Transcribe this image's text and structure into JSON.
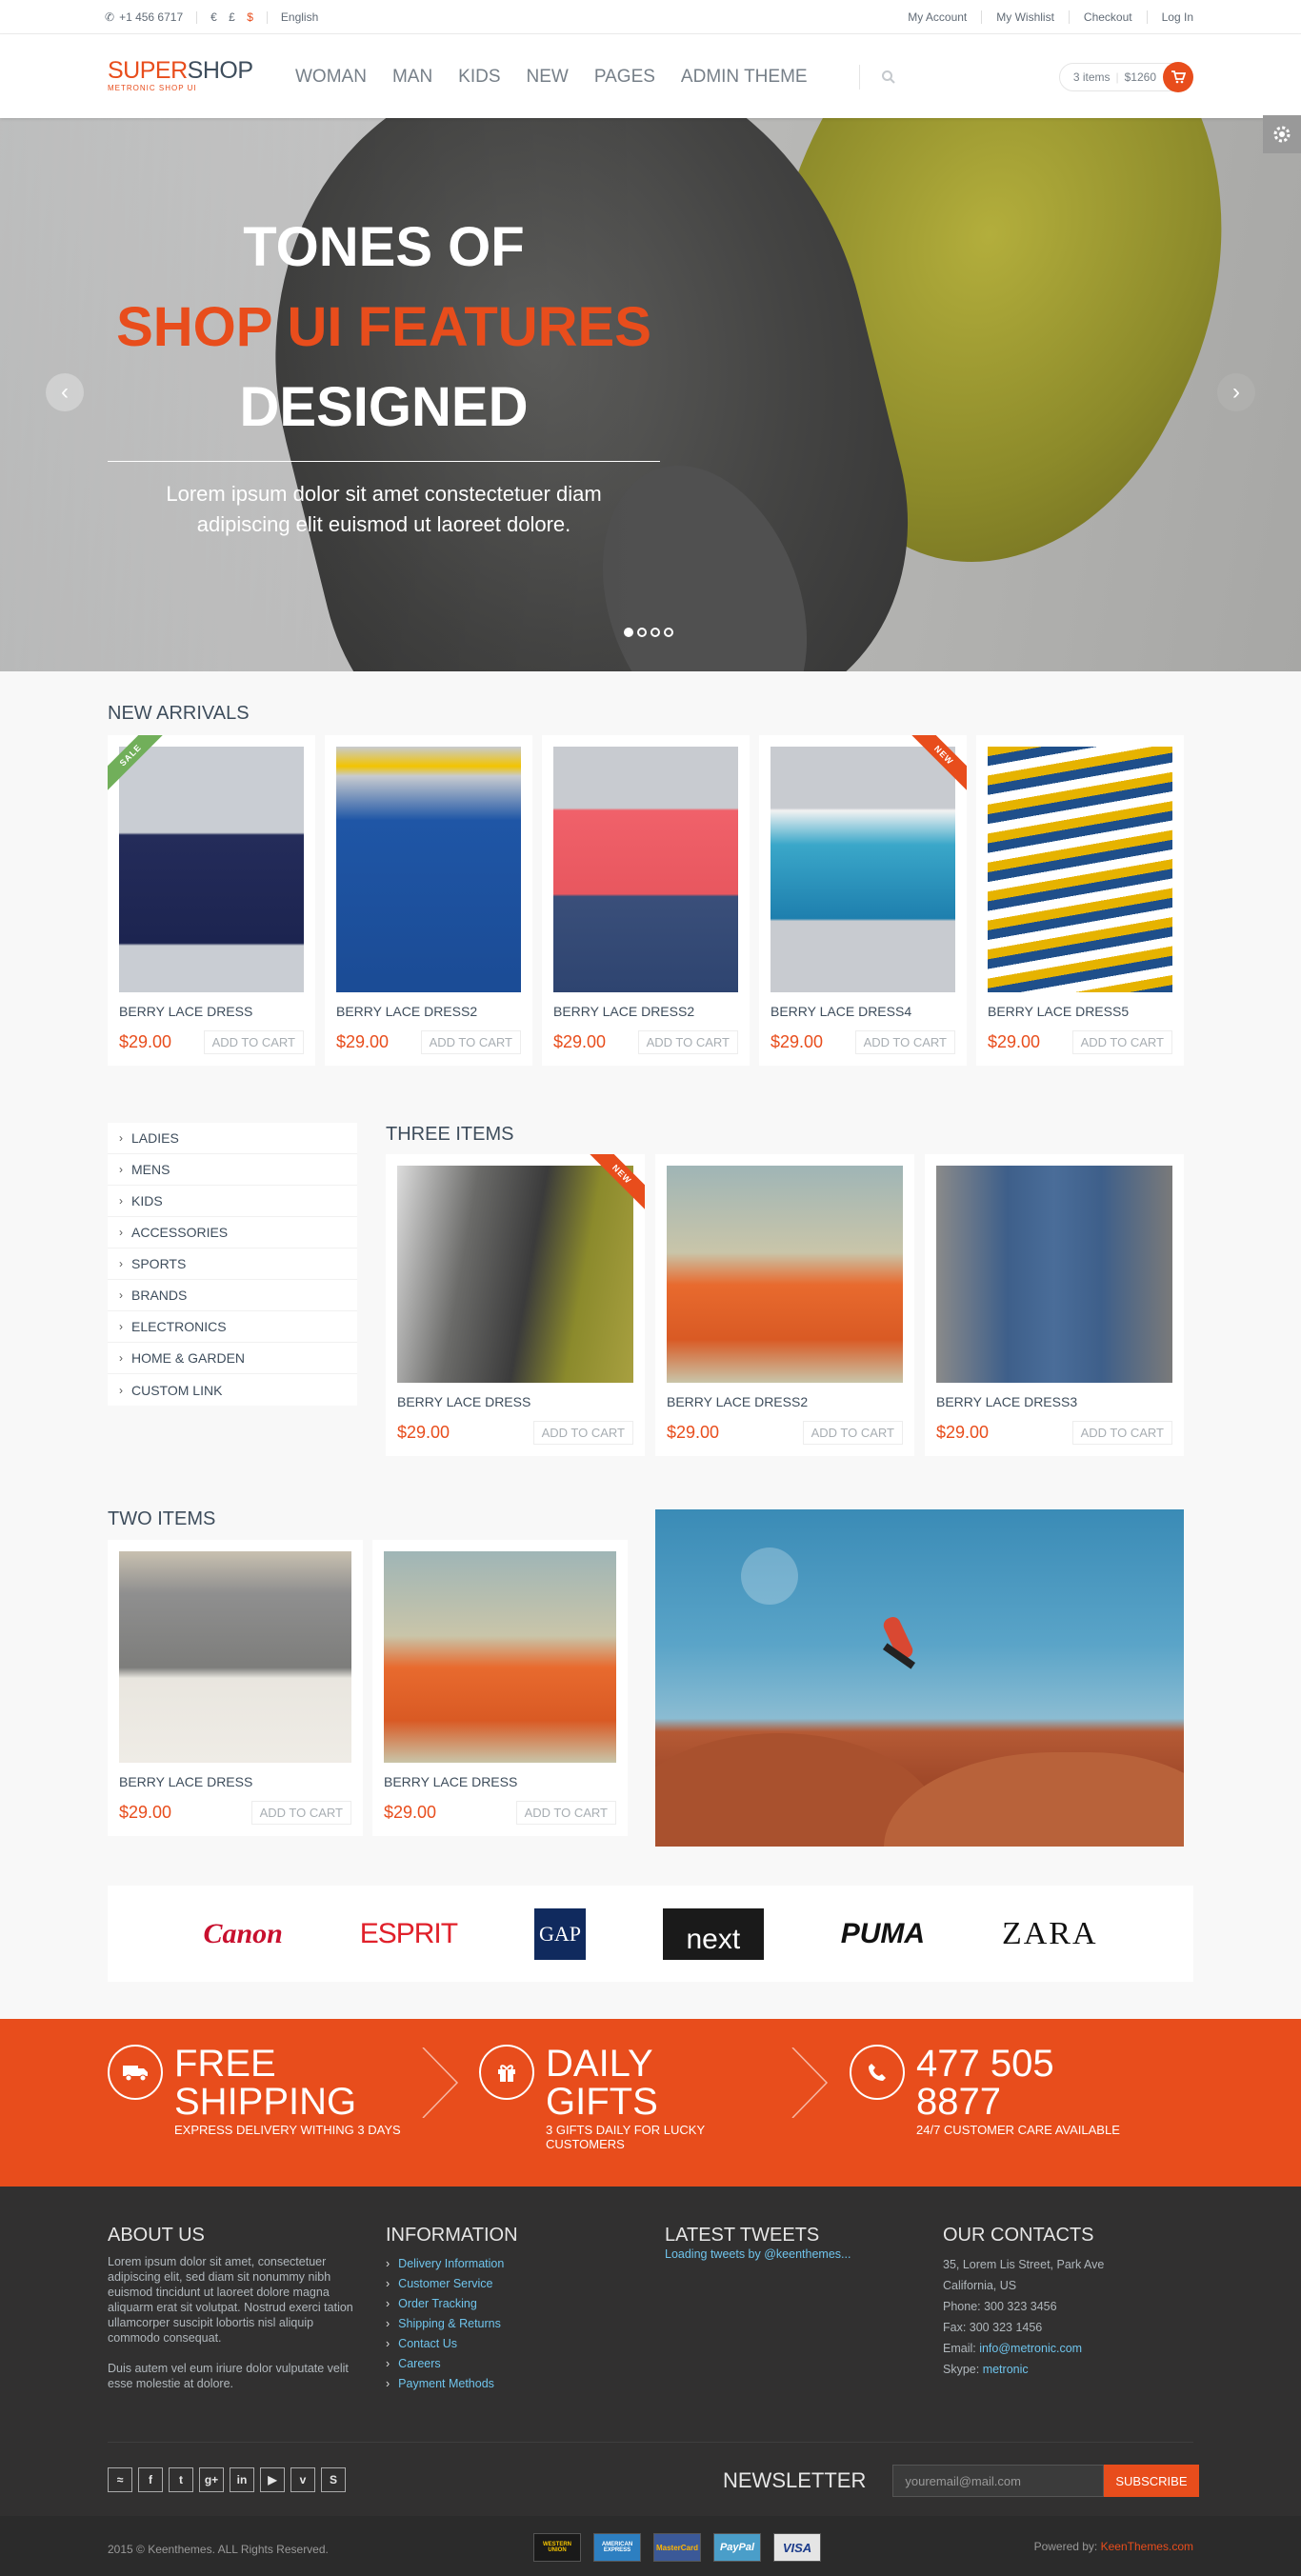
{
  "topbar": {
    "phone": "+1 456 6717",
    "currencies": [
      "€",
      "£",
      "$"
    ],
    "language": "English",
    "links": [
      "My Account",
      "My Wishlist",
      "Checkout",
      "Log In"
    ]
  },
  "header": {
    "logo_main": "SUPER",
    "logo_rest": "SHOP",
    "logo_sub": "METRONIC SHOP UI",
    "nav": [
      "WOMAN",
      "MAN",
      "KIDS",
      "NEW",
      "PAGES",
      "ADMIN THEME"
    ],
    "cart_items": "3 items",
    "cart_total": "$1260"
  },
  "slider": {
    "line1": "TONES OF",
    "line2": "SHOP UI FEATURES",
    "line3": "DESIGNED",
    "text": "Lorem ipsum dolor sit amet constectetuer diam adipiscing elit euismod ut laoreet dolore.",
    "active_dot": 1,
    "dot_count": 4
  },
  "new_arrivals": {
    "title": "NEW ARRIVALS",
    "sale_label": "SALE",
    "new_label": "NEW",
    "add_label": "ADD TO CART",
    "items": [
      {
        "name": "BERRY LACE DRESS",
        "price": "$29.00"
      },
      {
        "name": "BERRY LACE DRESS2",
        "price": "$29.00"
      },
      {
        "name": "BERRY LACE DRESS2",
        "price": "$29.00"
      },
      {
        "name": "BERRY LACE DRESS4",
        "price": "$29.00"
      },
      {
        "name": "BERRY LACE DRESS5",
        "price": "$29.00"
      }
    ]
  },
  "categories": [
    "LADIES",
    "MENS",
    "KIDS",
    "ACCESSORIES",
    "SPORTS",
    "BRANDS",
    "ELECTRONICS",
    "HOME & GARDEN",
    "CUSTOM LINK"
  ],
  "three_items": {
    "title": "THREE ITEMS",
    "items": [
      {
        "name": "BERRY LACE DRESS",
        "price": "$29.00"
      },
      {
        "name": "BERRY LACE DRESS2",
        "price": "$29.00"
      },
      {
        "name": "BERRY LACE DRESS3",
        "price": "$29.00"
      }
    ]
  },
  "two_items": {
    "title": "TWO ITEMS",
    "items": [
      {
        "name": "BERRY LACE DRESS",
        "price": "$29.00"
      },
      {
        "name": "BERRY LACE DRESS",
        "price": "$29.00"
      }
    ]
  },
  "brands": [
    "Canon",
    "ESPRIT",
    "GAP",
    "next",
    "PUMA",
    "ZARA"
  ],
  "steps": [
    {
      "title1": "FREE",
      "title2": "SHIPPING",
      "sub": "EXPRESS DELIVERY WITHING 3 DAYS"
    },
    {
      "title1": "DAILY",
      "title2": "GIFTS",
      "sub": "3 GIFTS DAILY FOR LUCKY CUSTOMERS"
    },
    {
      "title1": "477 505",
      "title2": "8877",
      "sub": "24/7 CUSTOMER CARE AVAILABLE"
    }
  ],
  "footer": {
    "about_title": "ABOUT US",
    "about_p1": "Lorem ipsum dolor sit amet, consectetuer adipiscing elit, sed diam sit nonummy nibh euismod tincidunt ut laoreet dolore magna aliquarm erat sit volutpat. Nostrud exerci tation ullamcorper suscipit lobortis nisl aliquip commodo consequat.",
    "about_p2": "Duis autem vel eum iriure dolor vulputate velit esse molestie at dolore.",
    "info_title": "INFORMATION",
    "info_links": [
      "Delivery Information",
      "Customer Service",
      "Order Tracking",
      "Shipping & Returns",
      "Contact Us",
      "Careers",
      "Payment Methods"
    ],
    "tweets_title": "LATEST TWEETS",
    "tweets_text": "Loading tweets by @keenthemes...",
    "contacts_title": "OUR CONTACTS",
    "address1": "35, Lorem Lis Street, Park Ave",
    "address2": "California, US",
    "phone": "Phone: 300 323 3456",
    "fax": "Fax: 300 323 1456",
    "email_label": "Email: ",
    "email": "info@metronic.com",
    "skype_label": "Skype: ",
    "skype": "metronic",
    "newsletter_label": "NEWSLETTER",
    "newsletter_placeholder": "youremail@mail.com",
    "subscribe": "SUBSCRIBE",
    "copyright": "2015 © Keenthemes. ALL Rights Reserved.",
    "powered_label": "Powered by: ",
    "powered": "KeenThemes.com",
    "payments": [
      "WESTERN UNION",
      "AMERICAN EXPRESS",
      "MasterCard",
      "PayPal",
      "VISA"
    ]
  },
  "colors": {
    "accent": "#e84d1c",
    "text": "#3e4d5c",
    "footer": "#313030"
  }
}
